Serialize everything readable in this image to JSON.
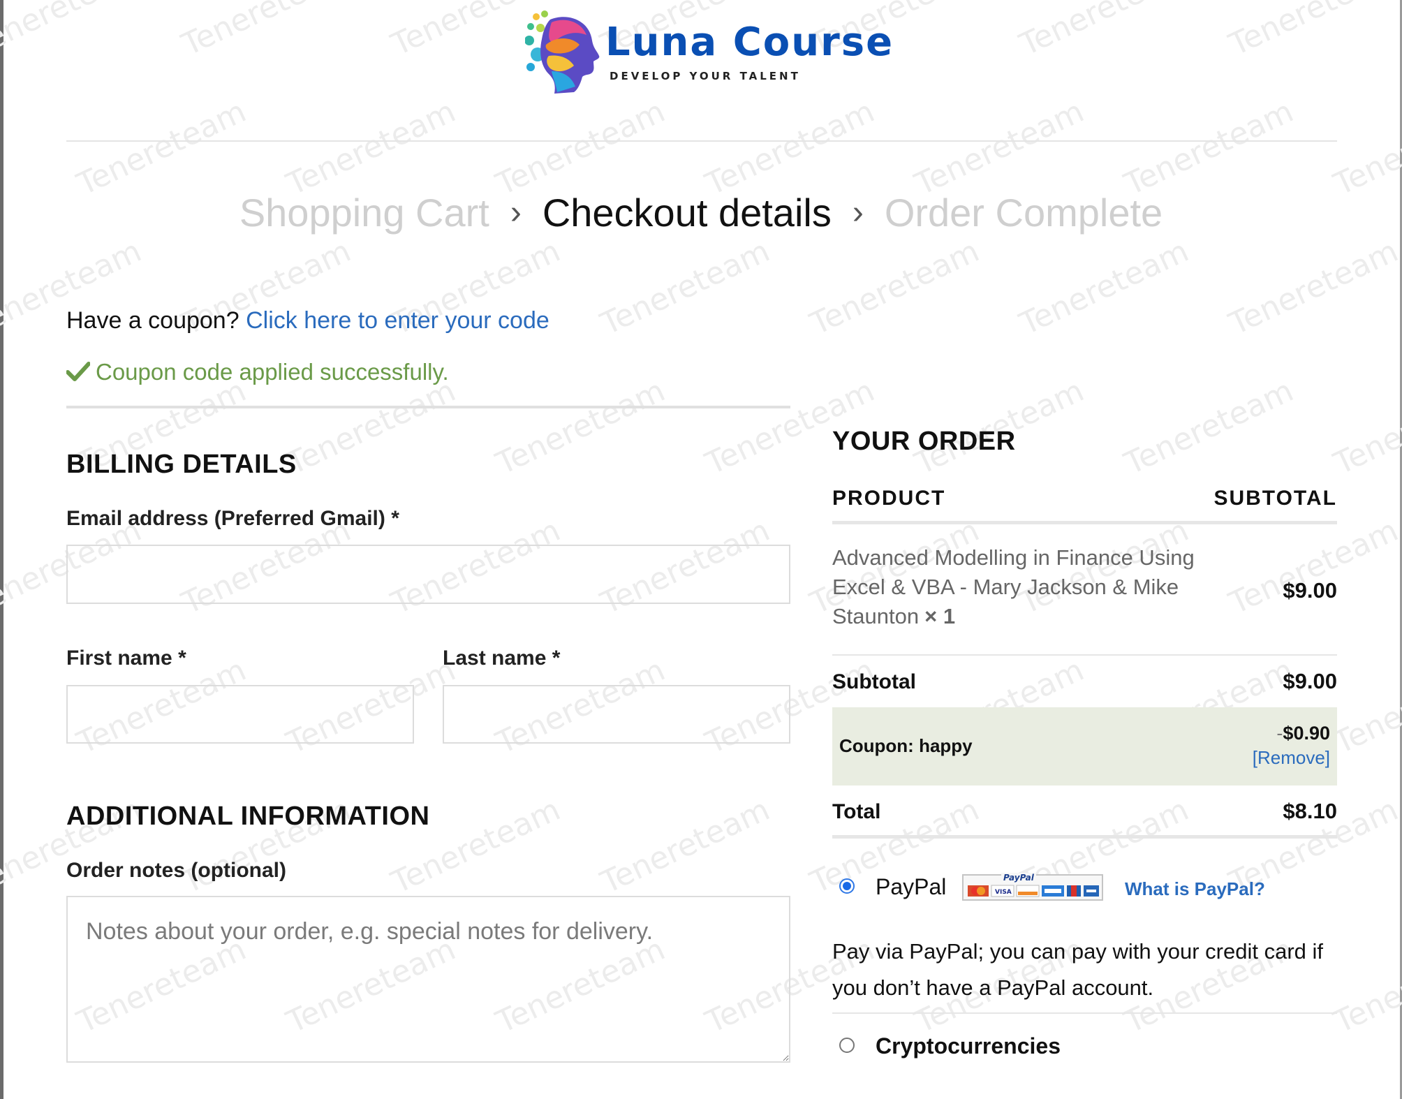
{
  "brand": {
    "name": "Luna Course",
    "tagline": "DEVELOP YOUR TALENT",
    "name_color": "#0a4fb3"
  },
  "watermark": "Tenereteam",
  "breadcrumb": {
    "steps": [
      "Shopping Cart",
      "Checkout details",
      "Order Complete"
    ],
    "active_index": 1
  },
  "coupon": {
    "prompt": "Have a coupon?",
    "link": "Click here to enter your code",
    "success_message": "Coupon code applied successfully."
  },
  "billing": {
    "heading": "BILLING DETAILS",
    "email_label": "Email address (Preferred Gmail)",
    "email_value": "",
    "first_name_label": "First name",
    "first_name_value": "",
    "last_name_label": "Last name",
    "last_name_value": "",
    "required_mark": "*"
  },
  "additional": {
    "heading": "ADDITIONAL INFORMATION",
    "notes_label": "Order notes (optional)",
    "notes_placeholder": "Notes about your order, e.g. special notes for delivery.",
    "notes_value": ""
  },
  "order": {
    "heading": "YOUR ORDER",
    "col_product": "PRODUCT",
    "col_subtotal": "SUBTOTAL",
    "items": [
      {
        "name": "Advanced Modelling in Finance Using Excel & VBA - Mary Jackson & Mike Staunton",
        "qty": "× 1",
        "price": "$9.00"
      }
    ],
    "subtotal_label": "Subtotal",
    "subtotal_value": "$9.00",
    "coupon_label": "Coupon: happy",
    "coupon_sign": "-",
    "coupon_value": "$0.90",
    "coupon_remove": "[Remove]",
    "total_label": "Total",
    "total_value": "$8.10"
  },
  "payment": {
    "methods": [
      {
        "name": "PayPal",
        "selected": true,
        "badge_icon": "paypal-card-logos-icon",
        "badge_text": "PayPal",
        "help_link": "What is PayPal?",
        "description": "Pay via PayPal; you can pay with your credit card if you don’t have a PayPal account."
      },
      {
        "name": "Cryptocurrencies",
        "selected": false
      }
    ]
  },
  "colors": {
    "link": "#2a6bbd",
    "success": "#6a9a48",
    "coupon_row_bg": "#e9ede1",
    "radio_selected": "#1a6ae6"
  }
}
